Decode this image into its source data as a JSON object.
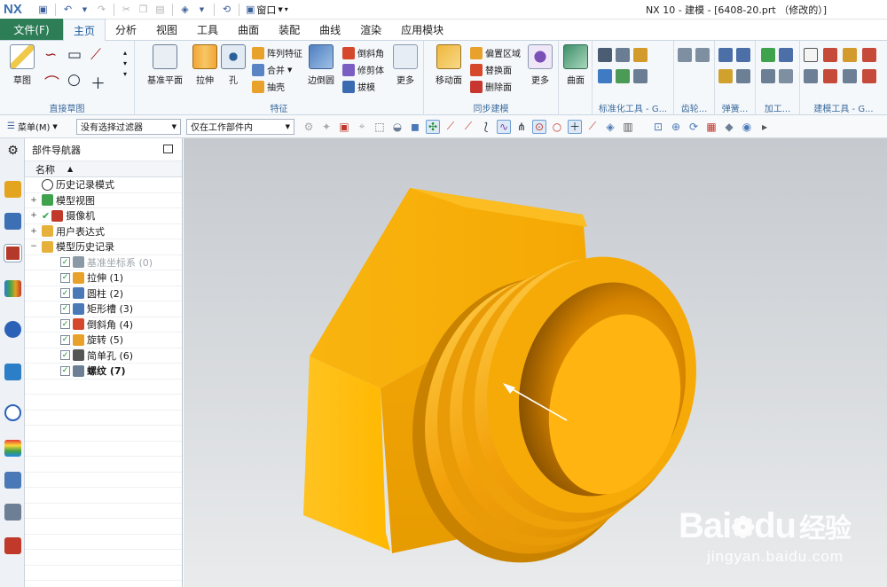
{
  "app": {
    "logo": "NX",
    "window_title": "NX 10 - 建模 - [6408-20.prt （修改的）]",
    "window_menu": "窗口"
  },
  "tabs": [
    "文件(F)",
    "主页",
    "分析",
    "视图",
    "工具",
    "曲面",
    "装配",
    "曲线",
    "渲染",
    "应用模块"
  ],
  "active_tab": "主页",
  "ribbon": {
    "direct_sketch": {
      "label": "直接草图",
      "sketch_button": "草图"
    },
    "feature": {
      "label": "特征",
      "datum_plane": "基准平面",
      "extrude": "拉伸",
      "hole": "孔",
      "pattern_feature": "阵列特征",
      "unite": "合并",
      "shell": "抽壳",
      "edge_blend": "边倒圆",
      "chamfer": "倒斜角",
      "trim_body": "修剪体",
      "draft": "拔模",
      "more": "更多"
    },
    "sync_modeling": {
      "label": "同步建模",
      "move_face": "移动面",
      "offset_region": "偏置区域",
      "replace_face": "替换面",
      "delete_face": "删除面",
      "more": "更多"
    },
    "surface": {
      "label": "曲面"
    },
    "standard_tools": {
      "label": "标准化工具 - G..."
    },
    "gear": {
      "label": "齿轮..."
    },
    "spring": {
      "label": "弹簧..."
    },
    "machining": {
      "label": "加工..."
    },
    "modeling_tools": {
      "label": "建模工具 - G..."
    }
  },
  "selection_bar": {
    "menu": "菜单(M)",
    "filter": "没有选择过滤器",
    "scope": "仅在工作部件内"
  },
  "navigator": {
    "title": "部件导航器",
    "column_name": "名称",
    "rows": [
      {
        "text": "历史记录模式",
        "icon": "clock-icon",
        "expand": "",
        "indent": 0,
        "check": false,
        "tick": false,
        "bold": false,
        "disabled": false
      },
      {
        "text": "模型视图",
        "icon": "model-view-icon",
        "expand": "+",
        "indent": 0,
        "check": false,
        "tick": false,
        "bold": false,
        "disabled": false
      },
      {
        "text": "摄像机",
        "icon": "camera-icon",
        "expand": "+",
        "indent": 0,
        "check": false,
        "tick": true,
        "bold": false,
        "disabled": false
      },
      {
        "text": "用户表达式",
        "icon": "folder-icon",
        "expand": "+",
        "indent": 0,
        "check": false,
        "tick": false,
        "bold": false,
        "disabled": false
      },
      {
        "text": "模型历史记录",
        "icon": "folder-open-icon",
        "expand": "−",
        "indent": 0,
        "check": false,
        "tick": false,
        "bold": false,
        "disabled": false
      },
      {
        "text": "基准坐标系 (0)",
        "icon": "datum-csys-icon",
        "expand": "",
        "indent": 1,
        "check": true,
        "tick": false,
        "bold": false,
        "disabled": true
      },
      {
        "text": "拉伸 (1)",
        "icon": "extrude-icon",
        "expand": "",
        "indent": 1,
        "check": true,
        "tick": false,
        "bold": false,
        "disabled": false
      },
      {
        "text": "圆柱 (2)",
        "icon": "cylinder-icon",
        "expand": "",
        "indent": 1,
        "check": true,
        "tick": false,
        "bold": false,
        "disabled": false
      },
      {
        "text": "矩形槽 (3)",
        "icon": "rect-groove-icon",
        "expand": "",
        "indent": 1,
        "check": true,
        "tick": false,
        "bold": false,
        "disabled": false
      },
      {
        "text": "倒斜角 (4)",
        "icon": "chamfer-icon",
        "expand": "",
        "indent": 1,
        "check": true,
        "tick": false,
        "bold": false,
        "disabled": false
      },
      {
        "text": "旋转 (5)",
        "icon": "revolve-icon",
        "expand": "",
        "indent": 1,
        "check": true,
        "tick": false,
        "bold": false,
        "disabled": false
      },
      {
        "text": "简单孔 (6)",
        "icon": "simple-hole-icon",
        "expand": "",
        "indent": 1,
        "check": true,
        "tick": false,
        "bold": false,
        "disabled": false
      },
      {
        "text": "螺纹 (7)",
        "icon": "thread-icon",
        "expand": "",
        "indent": 1,
        "check": true,
        "tick": false,
        "bold": true,
        "disabled": false
      }
    ]
  },
  "watermark": {
    "brand": "Bai",
    "brand2": "du",
    "cn": "经验",
    "url": "jingyan.baidu.com"
  },
  "colors": {
    "accent_green": "#2d7d57",
    "accent_blue": "#1c5a9c",
    "model_yellow": "#f5b50a"
  }
}
